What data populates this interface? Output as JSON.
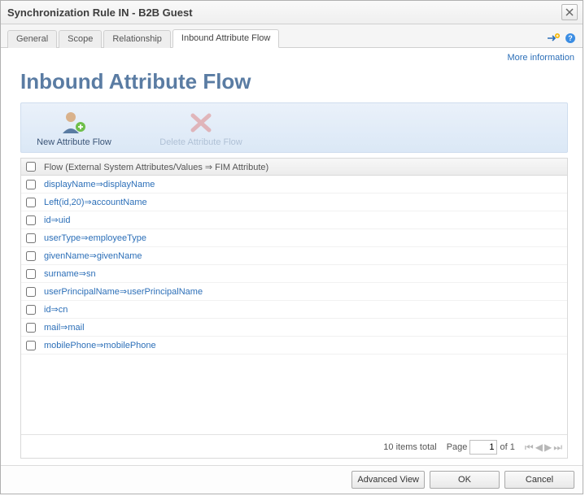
{
  "window": {
    "title": "Synchronization Rule IN - B2B Guest",
    "close_icon": "close-icon"
  },
  "tabs": [
    {
      "label": "General"
    },
    {
      "label": "Scope"
    },
    {
      "label": "Relationship"
    },
    {
      "label": "Inbound Attribute Flow",
      "active": true
    }
  ],
  "toolbar_icons": {
    "add": "add-rule-icon",
    "help": "help-icon"
  },
  "more_info": "More information",
  "page": {
    "title": "Inbound Attribute Flow"
  },
  "actions": {
    "new": "New Attribute Flow",
    "delete": "Delete Attribute Flow"
  },
  "table": {
    "header": "Flow (External System Attributes/Values ⇒ FIM Attribute)",
    "rows": [
      {
        "flow": "displayName⇒displayName"
      },
      {
        "flow": "Left(id,20)⇒accountName"
      },
      {
        "flow": "id⇒uid"
      },
      {
        "flow": "userType⇒employeeType"
      },
      {
        "flow": "givenName⇒givenName"
      },
      {
        "flow": "surname⇒sn"
      },
      {
        "flow": "userPrincipalName⇒userPrincipalName"
      },
      {
        "flow": "id⇒cn"
      },
      {
        "flow": "mail⇒mail"
      },
      {
        "flow": "mobilePhone⇒mobilePhone"
      }
    ]
  },
  "pager": {
    "total": "10 items total",
    "page_label": "Page",
    "current": "1",
    "of_label": "of 1"
  },
  "footer": {
    "advanced": "Advanced View",
    "ok": "OK",
    "cancel": "Cancel"
  }
}
